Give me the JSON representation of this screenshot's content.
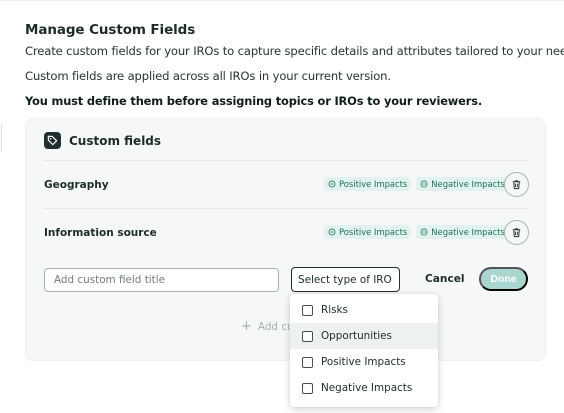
{
  "header": {
    "title": "Manage Custom Fields",
    "description_1": "Create custom fields for your IROs to capture specific details and attributes tailored to your needs.",
    "description_2": "Custom fields are applied across all IROs in your current version.",
    "warning": "You must define them before assigning topics or IROs to your reviewers."
  },
  "card": {
    "title": "Custom fields",
    "icon": "tag-icon",
    "fields": [
      {
        "label": "Geography",
        "chips": [
          "Positive Impacts",
          "Negative Impacts"
        ]
      },
      {
        "label": "Information source",
        "chips": [
          "Positive Impacts",
          "Negative Impacts"
        ]
      }
    ],
    "new_field": {
      "placeholder": "Add custom field title",
      "value": "",
      "select_label": "Select type of IRO",
      "cancel_label": "Cancel",
      "done_label": "Done"
    },
    "add_link": "Add cus"
  },
  "dropdown": {
    "options": [
      {
        "label": "Risks",
        "checked": false
      },
      {
        "label": "Opportunities",
        "checked": false
      },
      {
        "label": "Positive Impacts",
        "checked": false
      },
      {
        "label": "Negative Impacts",
        "checked": false
      }
    ]
  },
  "colors": {
    "chip_bg": "#e2f2ee",
    "chip_text": "#1f6e62",
    "done_bg": "#a9d6cf",
    "dark": "#1f2e2e"
  }
}
